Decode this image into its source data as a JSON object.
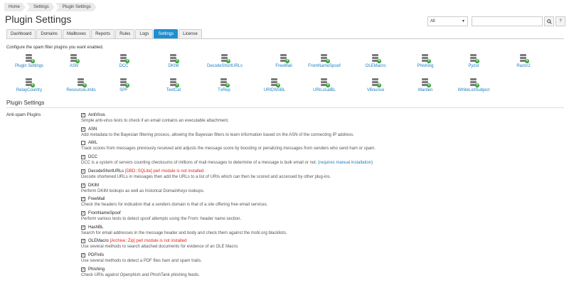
{
  "breadcrumb": [
    "Home",
    "Settings",
    "Plugin Settings"
  ],
  "page_title": "Plugin Settings",
  "search": {
    "select_value": "All",
    "input_value": ""
  },
  "tabs": [
    {
      "label": "Dashboard",
      "active": false
    },
    {
      "label": "Domains",
      "active": false
    },
    {
      "label": "Mailboxes",
      "active": false
    },
    {
      "label": "Reports",
      "active": false
    },
    {
      "label": "Rules",
      "active": false
    },
    {
      "label": "Logs",
      "active": false
    },
    {
      "label": "Settings",
      "active": true
    },
    {
      "label": "License",
      "active": false
    }
  ],
  "intro_text": "Configure the spam filter plugins you want enabled.",
  "plugins_row1": [
    "Plugin Settings",
    "ASN",
    "DCC",
    "DKIM",
    "DecodeShortURLs",
    "FreeMail",
    "FromNameSpoof",
    "OLEMacro",
    "Phishing",
    "Pyzor",
    "Razor2"
  ],
  "plugins_row2": [
    "RelayCountry",
    "ResourceLimits",
    "SPF",
    "TextCat",
    "TxRep",
    "URIDNSBL",
    "URILocalBL",
    "VBounce",
    "Warden",
    "WhiteListSubject"
  ],
  "section_title": "Plugin Settings",
  "anti_spam_label": "Anti-spam Plugins",
  "options": [
    {
      "name": "AntiVirus",
      "checked": true,
      "warn": "",
      "desc": "Simple anti-virus tests to check if an email contains an executable attachment.",
      "link": ""
    },
    {
      "name": "ASN",
      "checked": true,
      "warn": "",
      "desc": "Add metadata to the Bayesian filtering process, allowing the Bayesian filters to learn information based on the ASN of the connecting IP address.",
      "link": ""
    },
    {
      "name": "AWL",
      "checked": false,
      "warn": "",
      "desc": "Track scores from messages previously received and adjusts the message score by boosting or penalizing messages from senders who send ham or spam.",
      "link": ""
    },
    {
      "name": "DCC",
      "checked": true,
      "warn": "",
      "desc": "DCC is a system of servers counting checksums of millions of mail messages to determine of a message is bulk email or not.",
      "link": "(requires manual installation)"
    },
    {
      "name": "DecodeShortURLs",
      "checked": true,
      "warn": "[DBD::SQLite] perl module is not installed",
      "desc": "Decode shortened URLs in messages then add the URLs to a list of URIs which can then be scored and accessed by other plug-ins.",
      "link": ""
    },
    {
      "name": "DKIM",
      "checked": true,
      "warn": "",
      "desc": "Perform DKIM lookups as well as historical DomainKeys lookups.",
      "link": ""
    },
    {
      "name": "FreeMail",
      "checked": true,
      "warn": "",
      "desc": "Check the headers for indication that a senders domain is that of a site offering free email services.",
      "link": ""
    },
    {
      "name": "FromNameSpoof",
      "checked": true,
      "warn": "",
      "desc": "Perform various tests to detect spoof attempts using the From: header name section.",
      "link": ""
    },
    {
      "name": "HashBL",
      "checked": true,
      "warn": "",
      "desc": "Search for email addresses in the message header and body and check them against the msbl.org blacklists.",
      "link": ""
    },
    {
      "name": "OLEMacro",
      "checked": true,
      "warn": "[Archive::Zip] perl module is not installed",
      "desc": "Use several methods to search attached documents for evidence of an OLE Macro.",
      "link": ""
    },
    {
      "name": "PDFInfo",
      "checked": true,
      "warn": "",
      "desc": "Use several methods to detect a PDF files ham and spam traits.",
      "link": ""
    },
    {
      "name": "Phishing",
      "checked": true,
      "warn": "",
      "desc": "Check URIs against Openphish and PhishTank phishing feeds.",
      "link": ""
    }
  ],
  "icons": {
    "plugin": "database-add-icon",
    "search": "search-icon",
    "help": "help-icon",
    "checkbox": "check-icon"
  },
  "colors": {
    "accent": "#1d8fd1",
    "link": "#1d7fbf",
    "warn": "#e0241b"
  }
}
